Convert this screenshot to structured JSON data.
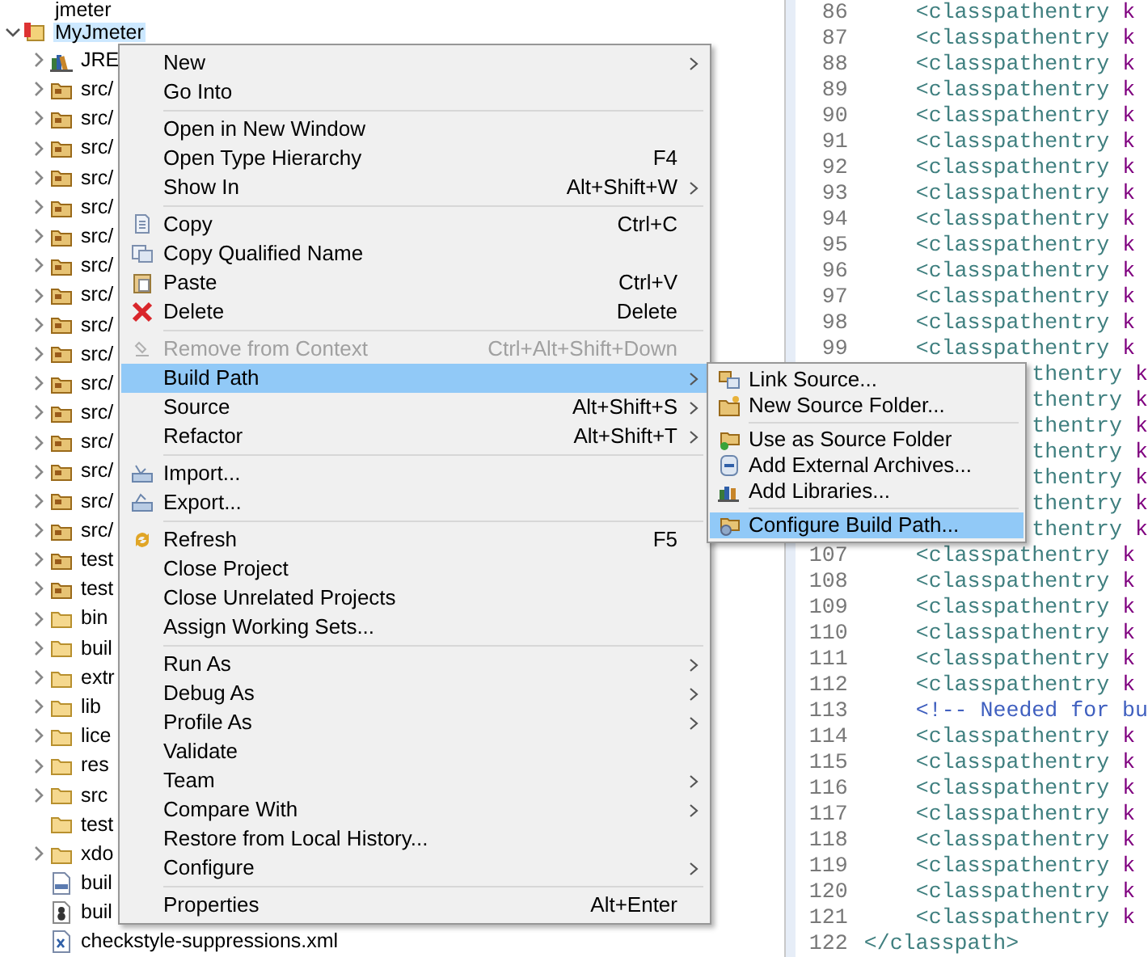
{
  "tree": [
    {
      "label": "jmeter",
      "kind": "project"
    },
    {
      "label": "MyJmeter",
      "kind": "project",
      "expanded": true,
      "selected": true,
      "children": [
        {
          "label": "JRE",
          "kind": "library",
          "expanded": false
        },
        {
          "label": "src/",
          "kind": "source-folder",
          "expanded": false
        },
        {
          "label": "src/",
          "kind": "source-folder",
          "expanded": false
        },
        {
          "label": "src/",
          "kind": "source-folder",
          "expanded": false
        },
        {
          "label": "src/",
          "kind": "source-folder",
          "expanded": false
        },
        {
          "label": "src/",
          "kind": "source-folder",
          "expanded": false
        },
        {
          "label": "src/",
          "kind": "source-folder",
          "expanded": false
        },
        {
          "label": "src/",
          "kind": "source-folder",
          "expanded": false
        },
        {
          "label": "src/",
          "kind": "source-folder",
          "expanded": false
        },
        {
          "label": "src/",
          "kind": "source-folder",
          "expanded": false
        },
        {
          "label": "src/",
          "kind": "source-folder",
          "expanded": false
        },
        {
          "label": "src/",
          "kind": "source-folder",
          "expanded": false
        },
        {
          "label": "src/",
          "kind": "source-folder",
          "expanded": false
        },
        {
          "label": "src/",
          "kind": "source-folder",
          "expanded": false
        },
        {
          "label": "src/",
          "kind": "source-folder",
          "expanded": false
        },
        {
          "label": "src/",
          "kind": "source-folder",
          "expanded": false
        },
        {
          "label": "src/",
          "kind": "source-folder",
          "expanded": false
        },
        {
          "label": "test",
          "kind": "source-folder",
          "expanded": false
        },
        {
          "label": "test",
          "kind": "source-folder",
          "expanded": false
        },
        {
          "label": "bin",
          "kind": "folder",
          "expanded": false
        },
        {
          "label": "buil",
          "kind": "folder",
          "expanded": false
        },
        {
          "label": "extr",
          "kind": "folder",
          "expanded": false
        },
        {
          "label": "lib",
          "kind": "folder",
          "expanded": false
        },
        {
          "label": "lice",
          "kind": "folder",
          "expanded": false
        },
        {
          "label": "res",
          "kind": "folder",
          "expanded": false
        },
        {
          "label": "src",
          "kind": "folder",
          "expanded": false
        },
        {
          "label": "test",
          "kind": "empty-folder"
        },
        {
          "label": "xdo",
          "kind": "folder",
          "expanded": false
        },
        {
          "label": "buil",
          "kind": "properties-file"
        },
        {
          "label": "buil",
          "kind": "ant-file"
        },
        {
          "label": "checkstyle-suppressions.xml",
          "kind": "xml-file"
        }
      ]
    }
  ],
  "context_menu": {
    "groups": [
      [
        {
          "label": "New",
          "submenu": true
        },
        {
          "label": "Go Into"
        }
      ],
      [
        {
          "label": "Open in New Window"
        },
        {
          "label": "Open Type Hierarchy",
          "shortcut": "F4"
        },
        {
          "label": "Show In",
          "shortcut": "Alt+Shift+W",
          "submenu": true
        }
      ],
      [
        {
          "label": "Copy",
          "shortcut": "Ctrl+C"
        },
        {
          "label": "Copy Qualified Name"
        },
        {
          "label": "Paste",
          "shortcut": "Ctrl+V"
        },
        {
          "label": "Delete",
          "shortcut": "Delete"
        }
      ],
      [
        {
          "label": "Remove from Context",
          "shortcut": "Ctrl+Alt+Shift+Down",
          "disabled": true,
          "selected": false
        },
        {
          "label": "Build Path",
          "submenu": true,
          "disabled": false,
          "selected": true
        },
        {
          "label": "Source",
          "shortcut": "Alt+Shift+S",
          "submenu": true,
          "disabled": false,
          "selected": false
        },
        {
          "label": "Refactor",
          "shortcut": "Alt+Shift+T",
          "submenu": true,
          "disabled": false,
          "selected": false
        }
      ],
      [
        {
          "label": "Import..."
        },
        {
          "label": "Export..."
        }
      ],
      [
        {
          "label": "Refresh",
          "shortcut": "F5"
        },
        {
          "label": "Close Project"
        },
        {
          "label": "Close Unrelated Projects"
        },
        {
          "label": "Assign Working Sets..."
        }
      ],
      [
        {
          "label": "Run As",
          "submenu": true
        },
        {
          "label": "Debug As",
          "submenu": true
        },
        {
          "label": "Profile As",
          "submenu": true
        },
        {
          "label": "Validate"
        },
        {
          "label": "Team",
          "submenu": true
        },
        {
          "label": "Compare With",
          "submenu": true
        },
        {
          "label": "Restore from Local History..."
        },
        {
          "label": "Configure",
          "submenu": true
        }
      ],
      [
        {
          "label": "Properties",
          "shortcut": "Alt+Enter"
        }
      ]
    ]
  },
  "submenu": {
    "groups": [
      [
        {
          "label": "Link Source...",
          "selected": false
        },
        {
          "label": "New Source Folder...",
          "selected": false
        }
      ],
      [
        {
          "label": "Use as Source Folder",
          "selected": false
        },
        {
          "label": "Add External Archives...",
          "selected": false
        },
        {
          "label": "Add Libraries...",
          "selected": false
        }
      ],
      [
        {
          "label": "Configure Build Path...",
          "selected": true
        }
      ]
    ]
  },
  "editor_lines": [
    {
      "number": "86",
      "kind": "entry",
      "tag": "<classpathentry",
      "attr": "k"
    },
    {
      "number": "87",
      "kind": "entry",
      "tag": "<classpathentry",
      "attr": "k"
    },
    {
      "number": "88",
      "kind": "entry",
      "tag": "<classpathentry",
      "attr": "k"
    },
    {
      "number": "89",
      "kind": "entry",
      "tag": "<classpathentry",
      "attr": "k"
    },
    {
      "number": "90",
      "kind": "entry",
      "tag": "<classpathentry",
      "attr": "k"
    },
    {
      "number": "91",
      "kind": "entry",
      "tag": "<classpathentry",
      "attr": "k"
    },
    {
      "number": "92",
      "kind": "entry",
      "tag": "<classpathentry",
      "attr": "k"
    },
    {
      "number": "93",
      "kind": "entry",
      "tag": "<classpathentry",
      "attr": "k"
    },
    {
      "number": "94",
      "kind": "entry",
      "tag": "<classpathentry",
      "attr": "k"
    },
    {
      "number": "95",
      "kind": "entry",
      "tag": "<classpathentry",
      "attr": "k"
    },
    {
      "number": "96",
      "kind": "entry",
      "tag": "<classpathentry",
      "attr": "k"
    },
    {
      "number": "97",
      "kind": "entry",
      "tag": "<classpathentry",
      "attr": "k"
    },
    {
      "number": "98",
      "kind": "entry",
      "tag": "<classpathentry",
      "attr": "k"
    },
    {
      "number": "99",
      "kind": "entry",
      "tag": "<classpathentry",
      "attr": "k"
    },
    {
      "kind": "partial",
      "tag": "thentry",
      "attr": "k"
    },
    {
      "kind": "partial",
      "tag": "thentry",
      "attr": "k"
    },
    {
      "kind": "partial",
      "tag": "thentry",
      "attr": "k"
    },
    {
      "kind": "partial",
      "tag": "thentry",
      "attr": "k"
    },
    {
      "kind": "partial",
      "tag": "thentry",
      "attr": "k"
    },
    {
      "kind": "partial",
      "tag": "thentry",
      "attr": "k"
    },
    {
      "kind": "partial",
      "tag": "thentry",
      "attr": "k"
    },
    {
      "number": "107",
      "kind": "entry",
      "tag": "<classpathentry",
      "attr": "k"
    },
    {
      "number": "108",
      "kind": "entry",
      "tag": "<classpathentry",
      "attr": "k"
    },
    {
      "number": "109",
      "kind": "entry",
      "tag": "<classpathentry",
      "attr": "k"
    },
    {
      "number": "110",
      "kind": "entry",
      "tag": "<classpathentry",
      "attr": "k"
    },
    {
      "number": "111",
      "kind": "entry",
      "tag": "<classpathentry",
      "attr": "k"
    },
    {
      "number": "112",
      "kind": "entry",
      "tag": "<classpathentry",
      "attr": "k"
    },
    {
      "number": "113",
      "kind": "comment",
      "tag": "<!-- Needed for bu"
    },
    {
      "number": "114",
      "kind": "entry",
      "tag": "<classpathentry",
      "attr": "k"
    },
    {
      "number": "115",
      "kind": "entry",
      "tag": "<classpathentry",
      "attr": "k"
    },
    {
      "number": "116",
      "kind": "entry",
      "tag": "<classpathentry",
      "attr": "k"
    },
    {
      "number": "117",
      "kind": "entry",
      "tag": "<classpathentry",
      "attr": "k"
    },
    {
      "number": "118",
      "kind": "entry",
      "tag": "<classpathentry",
      "attr": "k"
    },
    {
      "number": "119",
      "kind": "entry",
      "tag": "<classpathentry",
      "attr": "k"
    },
    {
      "number": "120",
      "kind": "entry",
      "tag": "<classpathentry",
      "attr": "k"
    },
    {
      "number": "121",
      "kind": "entry",
      "tag": "<classpathentry",
      "attr": "k"
    },
    {
      "number": "122",
      "kind": "close",
      "tag": "</classpath>"
    }
  ]
}
